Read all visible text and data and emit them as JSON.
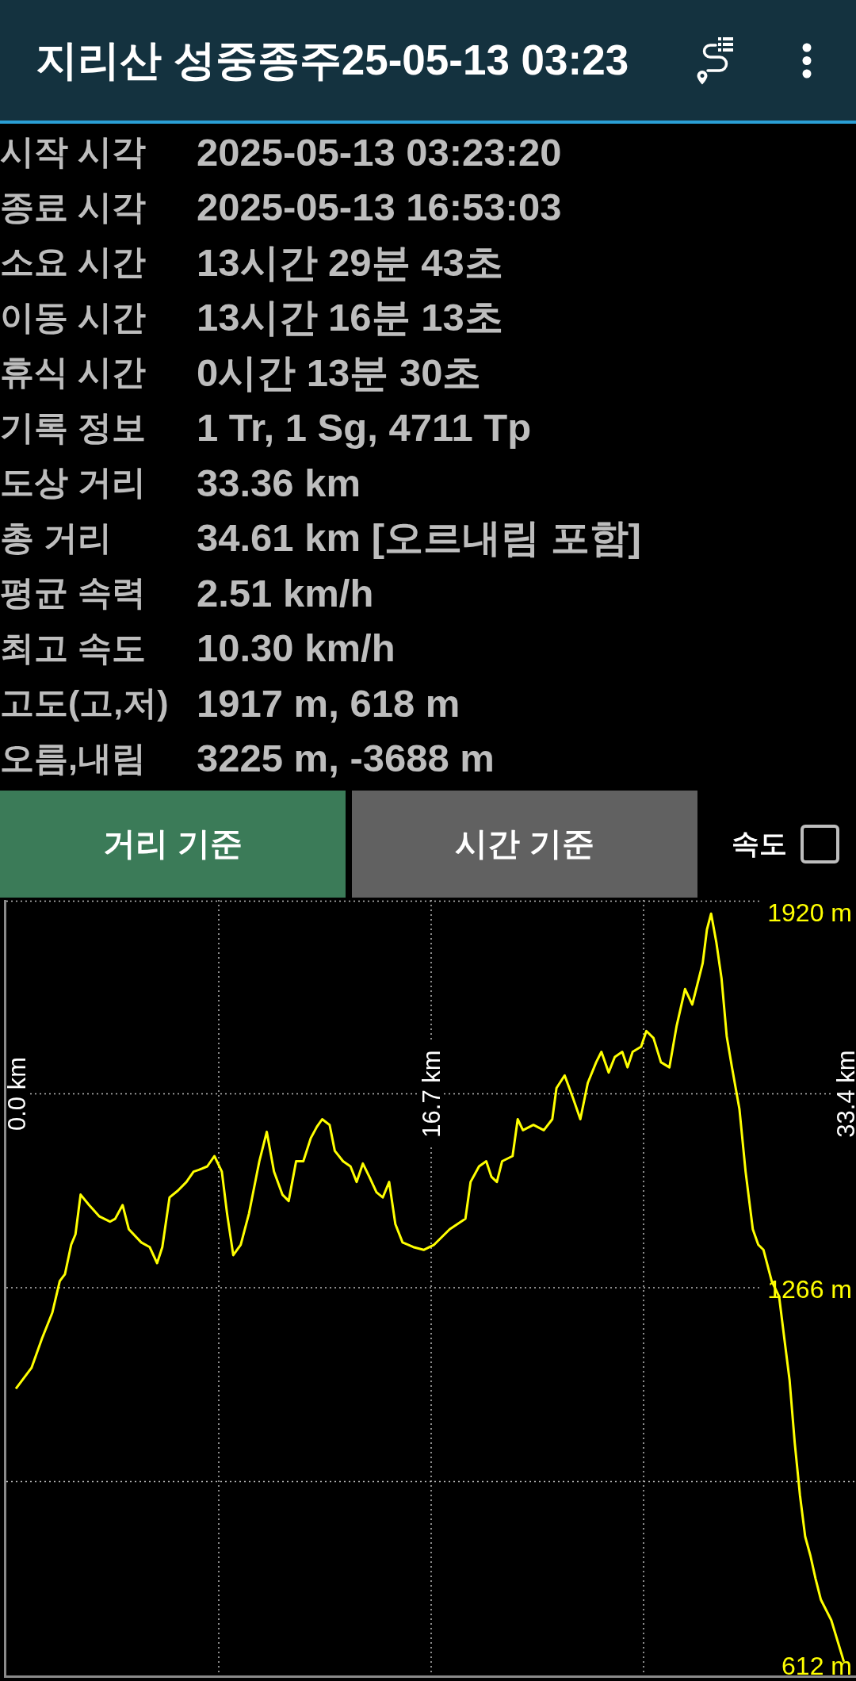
{
  "app_bar": {
    "title": "지리산 성중종주25-05-13 03:23"
  },
  "stats": [
    {
      "label": "시작 시각",
      "value": "2025-05-13 03:23:20"
    },
    {
      "label": "종료 시각",
      "value": "2025-05-13 16:53:03"
    },
    {
      "label": "소요 시간",
      "value": "13시간 29분 43초"
    },
    {
      "label": "이동 시간",
      "value": "13시간 16분 13초"
    },
    {
      "label": "휴식 시간",
      "value": "0시간 13분 30초"
    },
    {
      "label": "기록 정보",
      "value": "1 Tr, 1 Sg, 4711 Tp"
    },
    {
      "label": "도상 거리",
      "value": "33.36 km"
    },
    {
      "label": "총 거리",
      "value": "34.61 km [오르내림 포함]"
    },
    {
      "label": "평균 속력",
      "value": "2.51 km/h"
    },
    {
      "label": "최고 속도",
      "value": "10.30 km/h"
    },
    {
      "label": "고도(고,저)",
      "value": "1917 m, 618 m"
    },
    {
      "label": "오름,내림",
      "value": "3225 m, -3688 m"
    }
  ],
  "mode_tabs": [
    {
      "label": "거리 기준",
      "selected": true
    },
    {
      "label": "시간 기준",
      "selected": false
    }
  ],
  "speed_toggle": {
    "label": "속도",
    "checked": false
  },
  "elevation_chart": {
    "chart_data": {
      "type": "line",
      "xlim": [
        0,
        33.4
      ],
      "ylim": [
        612,
        1920
      ],
      "xticks": [
        {
          "value": 0,
          "label": "0.0 km"
        },
        {
          "value": 16.7,
          "label": "16.7 km"
        },
        {
          "value": 33.4,
          "label": "33.4 km"
        }
      ],
      "yticks": [
        {
          "value": 1920,
          "label": "1920 m"
        },
        {
          "value": 1266,
          "label": "1266 m"
        },
        {
          "value": 612,
          "label": "612 m"
        }
      ],
      "x": [
        0,
        0.63,
        1.05,
        1.47,
        1.77,
        1.98,
        2.23,
        2.4,
        2.61,
        2.95,
        3.37,
        3.79,
        4.0,
        4.3,
        4.55,
        5.05,
        5.39,
        5.69,
        5.9,
        6.19,
        6.53,
        6.87,
        7.16,
        7.37,
        7.71,
        8.0,
        8.3,
        8.51,
        8.76,
        9.06,
        9.39,
        9.81,
        10.11,
        10.4,
        10.74,
        10.99,
        11.29,
        11.58,
        11.88,
        12.13,
        12.34,
        12.64,
        12.85,
        13.18,
        13.48,
        13.73,
        13.98,
        14.24,
        14.53,
        14.78,
        15.04,
        15.29,
        15.58,
        16.01,
        16.43,
        16.85,
        17.48,
        18.11,
        18.32,
        18.66,
        18.95,
        19.16,
        19.38,
        19.59,
        20.01,
        20.22,
        20.43,
        20.85,
        21.27,
        21.61,
        21.78,
        22.11,
        22.45,
        22.74,
        23.04,
        23.38,
        23.59,
        23.88,
        24.13,
        24.43,
        24.64,
        24.85,
        25.19,
        25.4,
        25.69,
        25.99,
        26.33,
        26.62,
        26.96,
        27.25,
        27.46,
        27.67,
        27.84,
        28.01,
        28.22,
        28.43,
        28.64,
        28.85,
        29.15,
        29.4,
        29.69,
        29.91,
        30.12,
        30.45,
        30.75,
        30.96,
        31.17,
        31.38,
        31.59,
        31.8,
        32.01,
        32.22,
        32.43,
        32.85,
        33.36
      ],
      "series": [
        {
          "color": "#ffff00",
          "values": [
            1092,
            1128,
            1179,
            1224,
            1279,
            1291,
            1342,
            1360,
            1429,
            1411,
            1391,
            1382,
            1387,
            1411,
            1369,
            1346,
            1338,
            1310,
            1338,
            1424,
            1436,
            1451,
            1469,
            1472,
            1478,
            1496,
            1469,
            1396,
            1324,
            1342,
            1396,
            1487,
            1538,
            1469,
            1429,
            1418,
            1487,
            1487,
            1527,
            1547,
            1560,
            1550,
            1505,
            1487,
            1478,
            1451,
            1483,
            1460,
            1433,
            1424,
            1451,
            1378,
            1346,
            1338,
            1333,
            1342,
            1369,
            1387,
            1451,
            1478,
            1487,
            1460,
            1451,
            1487,
            1496,
            1560,
            1541,
            1550,
            1541,
            1560,
            1614,
            1636,
            1596,
            1560,
            1623,
            1659,
            1677,
            1641,
            1668,
            1677,
            1650,
            1677,
            1686,
            1713,
            1701,
            1659,
            1650,
            1722,
            1786,
            1759,
            1795,
            1831,
            1889,
            1917,
            1867,
            1804,
            1704,
            1650,
            1578,
            1469,
            1369,
            1342,
            1333,
            1279,
            1252,
            1179,
            1107,
            998,
            907,
            835,
            802,
            762,
            726,
            690,
            618
          ]
        }
      ]
    }
  }
}
